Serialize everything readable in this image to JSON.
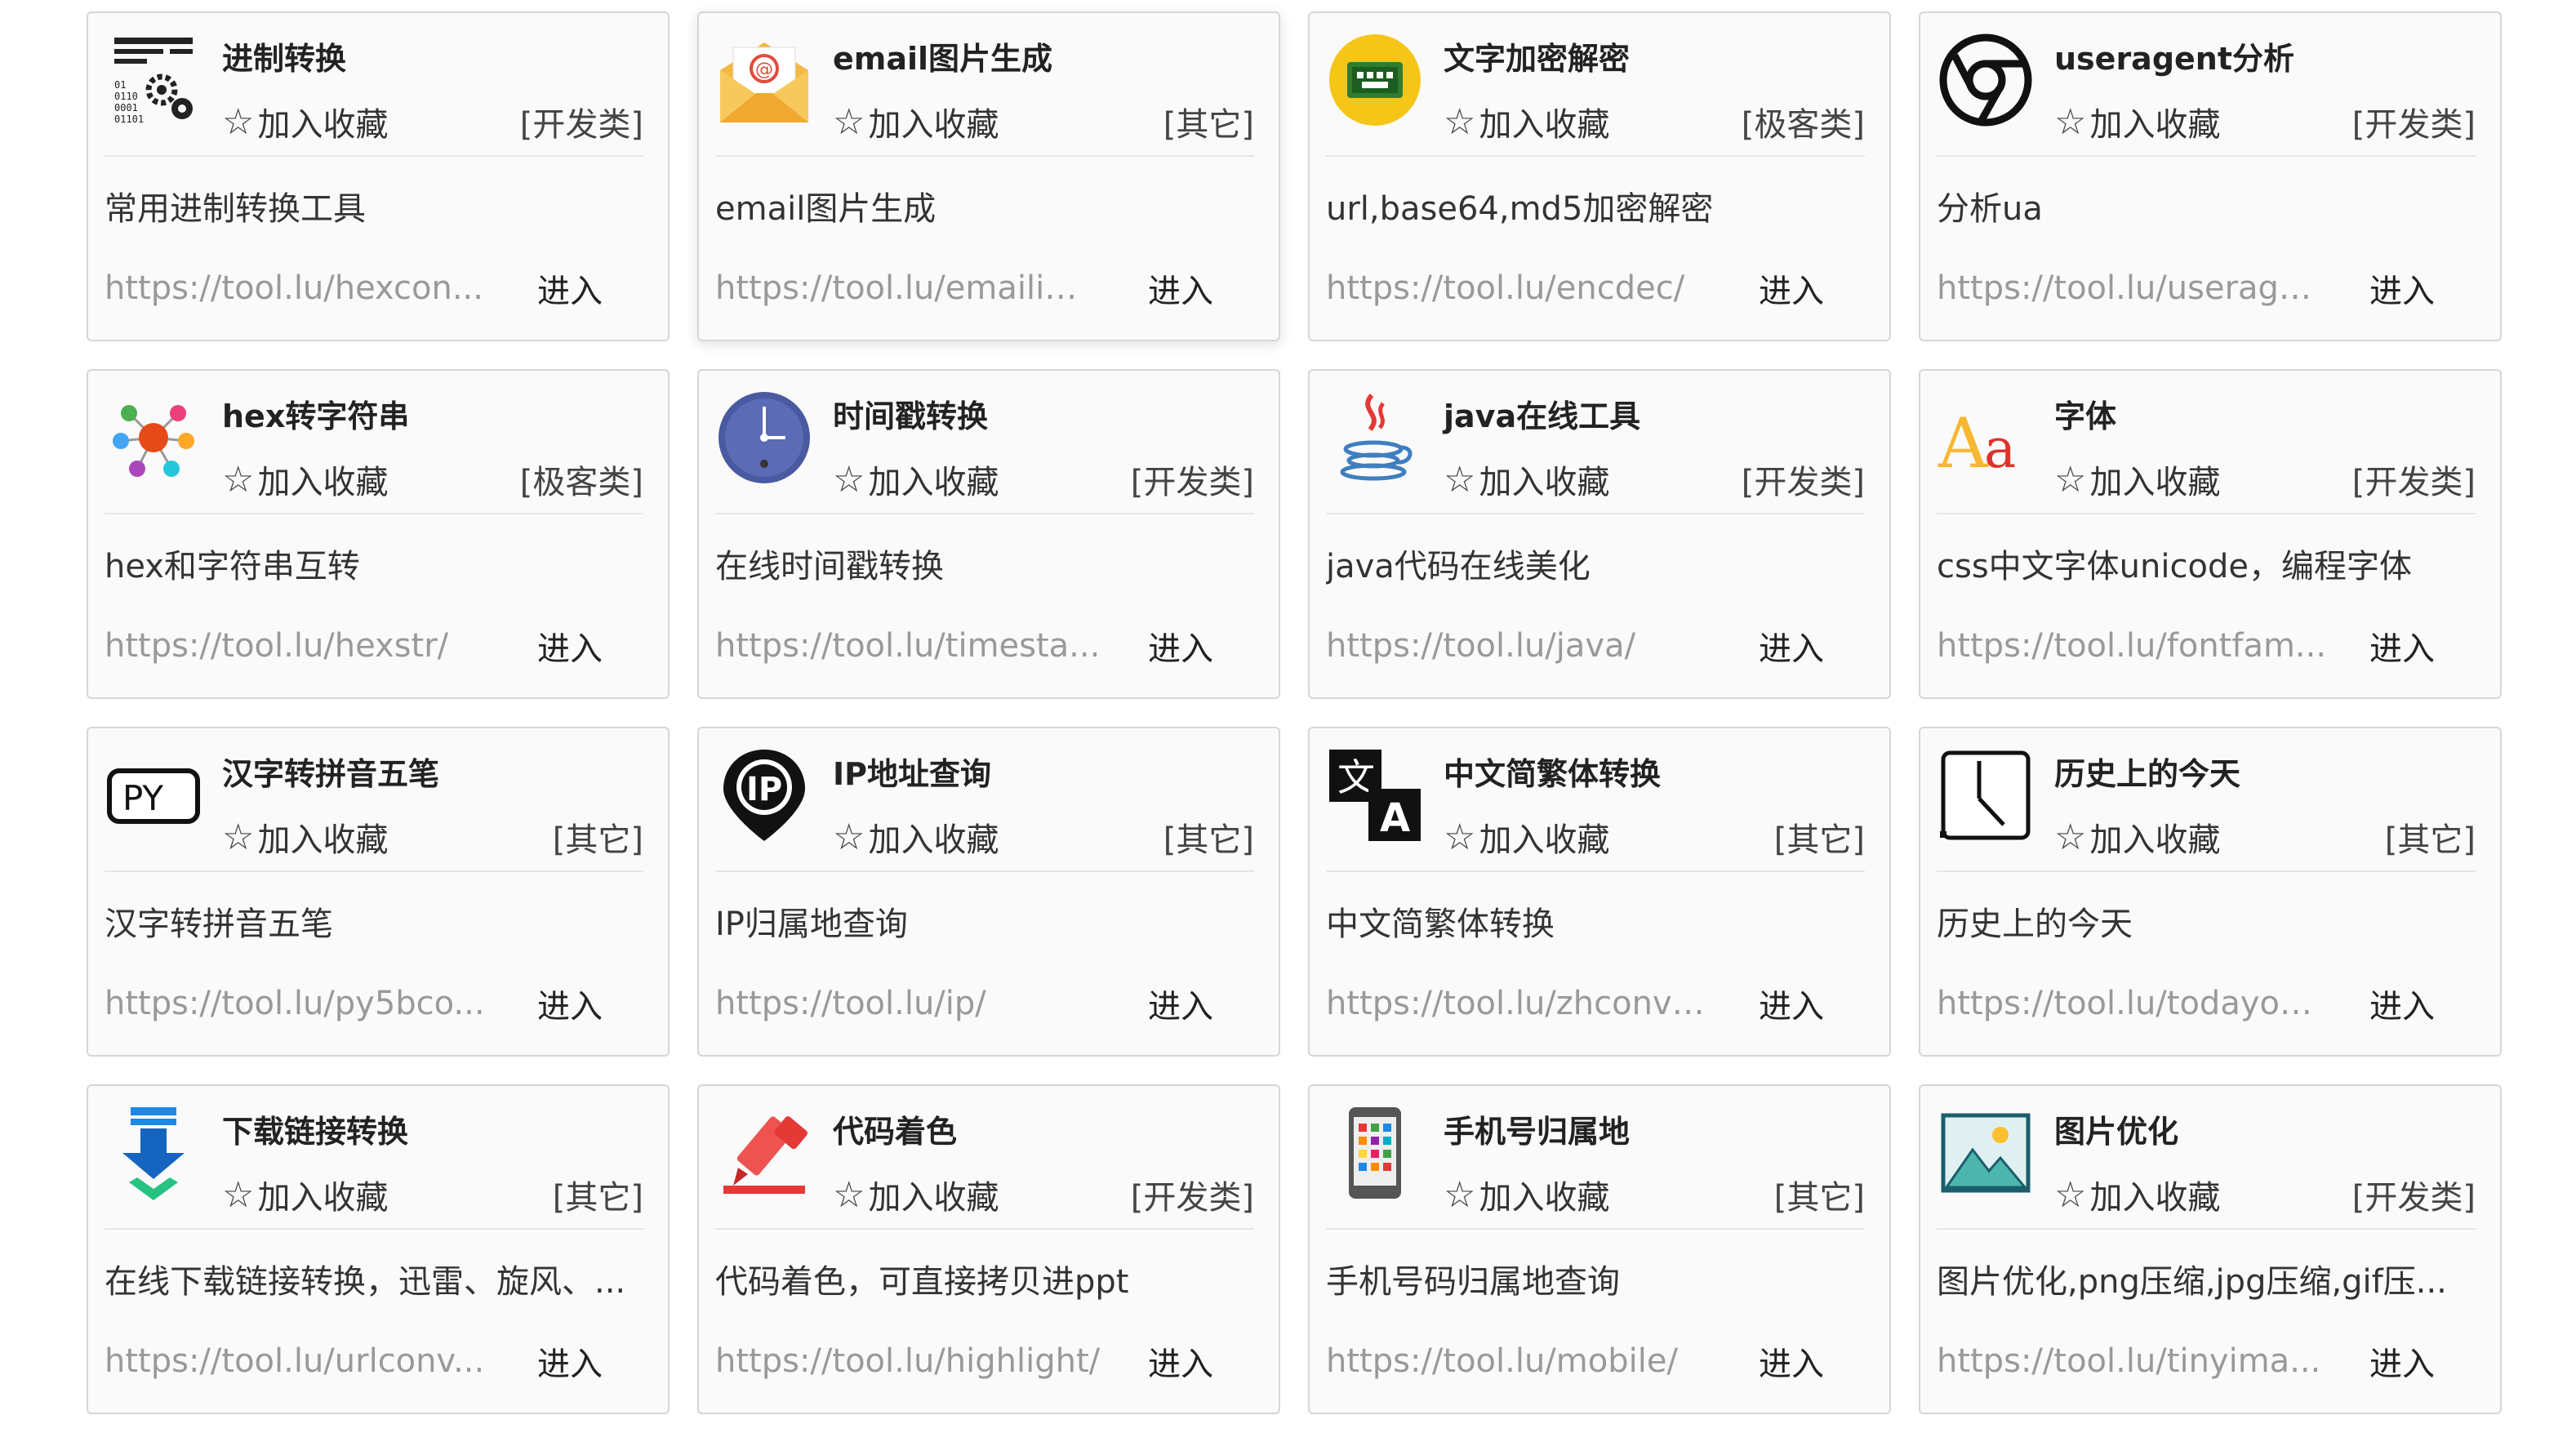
{
  "common": {
    "fav_label": "加入收藏",
    "star": "☆",
    "enter_label": "进入"
  },
  "cards": [
    {
      "name": "进制转换",
      "cat": "[开发类]",
      "desc": "常用进制转换工具",
      "url": "https://tool.lu/hexcon...",
      "icon": "binary-gears-icon"
    },
    {
      "name": "email图片生成",
      "cat": "[其它]",
      "desc": "email图片生成",
      "url": "https://tool.lu/emailim...",
      "icon": "envelope-icon"
    },
    {
      "name": "文字加密解密",
      "cat": "[极客类]",
      "desc": "url,base64,md5加密解密",
      "url": "https://tool.lu/encdec/",
      "icon": "cipher-screen-icon"
    },
    {
      "name": "useragent分析",
      "cat": "[开发类]",
      "desc": "分析ua",
      "url": "https://tool.lu/userage...",
      "icon": "browser-icon"
    },
    {
      "name": "hex转字符串",
      "cat": "[极客类]",
      "desc": "hex和字符串互转",
      "url": "https://tool.lu/hexstr/",
      "icon": "molecule-icon"
    },
    {
      "name": "时间戳转换",
      "cat": "[开发类]",
      "desc": "在线时间戳转换",
      "url": "https://tool.lu/timesta...",
      "icon": "clock-icon"
    },
    {
      "name": "java在线工具",
      "cat": "[开发类]",
      "desc": "java代码在线美化",
      "url": "https://tool.lu/java/",
      "icon": "java-cup-icon"
    },
    {
      "name": "字体",
      "cat": "[开发类]",
      "desc": "css中文字体unicode，编程字体",
      "url": "https://tool.lu/fontfam...",
      "icon": "font-aa-icon"
    },
    {
      "name": "汉字转拼音五笔",
      "cat": "[其它]",
      "desc": "汉字转拼音五笔",
      "url": "https://tool.lu/py5bco...",
      "icon": "py-keyboard-icon"
    },
    {
      "name": "IP地址查询",
      "cat": "[其它]",
      "desc": "IP归属地查询",
      "url": "https://tool.lu/ip/",
      "icon": "ip-pin-icon"
    },
    {
      "name": "中文简繁体转换",
      "cat": "[其它]",
      "desc": "中文简繁体转换",
      "url": "https://tool.lu/zhconve...",
      "icon": "translate-icon"
    },
    {
      "name": "历史上的今天",
      "cat": "[其它]",
      "desc": "历史上的今天",
      "url": "https://tool.lu/todayon...",
      "icon": "calendar-clock-icon"
    },
    {
      "name": "下载链接转换",
      "cat": "[其它]",
      "desc": "在线下载链接转换，迅雷、旋风、...",
      "url": "https://tool.lu/urlconv...",
      "icon": "download-icon"
    },
    {
      "name": "代码着色",
      "cat": "[开发类]",
      "desc": "代码着色，可直接拷贝进ppt",
      "url": "https://tool.lu/highlight/",
      "icon": "marker-icon"
    },
    {
      "name": "手机号归属地",
      "cat": "[其它]",
      "desc": "手机号码归属地查询",
      "url": "https://tool.lu/mobile/",
      "icon": "phone-icon"
    },
    {
      "name": "图片优化",
      "cat": "[开发类]",
      "desc": "图片优化,png压缩,jpg压缩,gif压...",
      "url": "https://tool.lu/tinyima...",
      "icon": "image-icon"
    }
  ]
}
